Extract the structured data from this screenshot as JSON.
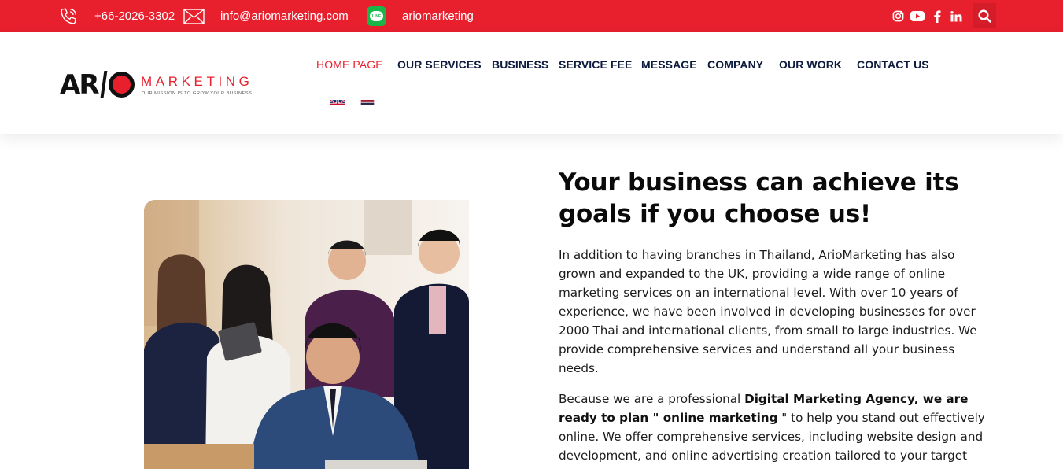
{
  "topbar": {
    "phone": "+66-2026-3302",
    "email": "info@ariomarketing.com",
    "line_id": "ariomarketing",
    "line_badge": "LINE",
    "social_icons": [
      "instagram-icon",
      "youtube-icon",
      "facebook-icon",
      "linkedin-icon"
    ],
    "accent_color": "#e8202e"
  },
  "logo": {
    "mark": "AR",
    "word": "MARKETING",
    "tagline": "OUR MISSION IS TO GROW YOUR BUSINESS"
  },
  "nav": {
    "items": [
      {
        "label": "HOME PAGE",
        "active": true
      },
      {
        "label": "OUR SERVICES",
        "active": false
      },
      {
        "label": "BUSINESS",
        "active": false
      },
      {
        "label": "SERVICE FEE",
        "active": false
      },
      {
        "label": "MESSAGE",
        "active": false
      },
      {
        "label": "COMPANY",
        "active": false
      },
      {
        "label": "OUR WORK",
        "active": false
      },
      {
        "label": "CONTACT US",
        "active": false
      }
    ],
    "languages": [
      "uk-flag-icon",
      "thai-flag-icon"
    ]
  },
  "hero": {
    "heading": "Your business can achieve its goals if you choose us!",
    "paragraph1": "In addition to having branches in Thailand, ArioMarketing has also grown and expanded to the UK, providing a wide range of online marketing services on an international level. With over 10 years of experience, we have been involved in developing businesses for over 2000 Thai and international clients, from small to large industries. We provide comprehensive services and understand all your business needs.",
    "paragraph2": {
      "t1": "Because we are a professional ",
      "b1": "Digital Marketing Agency, we are ready to plan \" online marketing",
      "t2": " \" to help you stand out effectively online. We offer comprehensive services, including website design and development, and online advertising creation tailored to your target"
    }
  }
}
